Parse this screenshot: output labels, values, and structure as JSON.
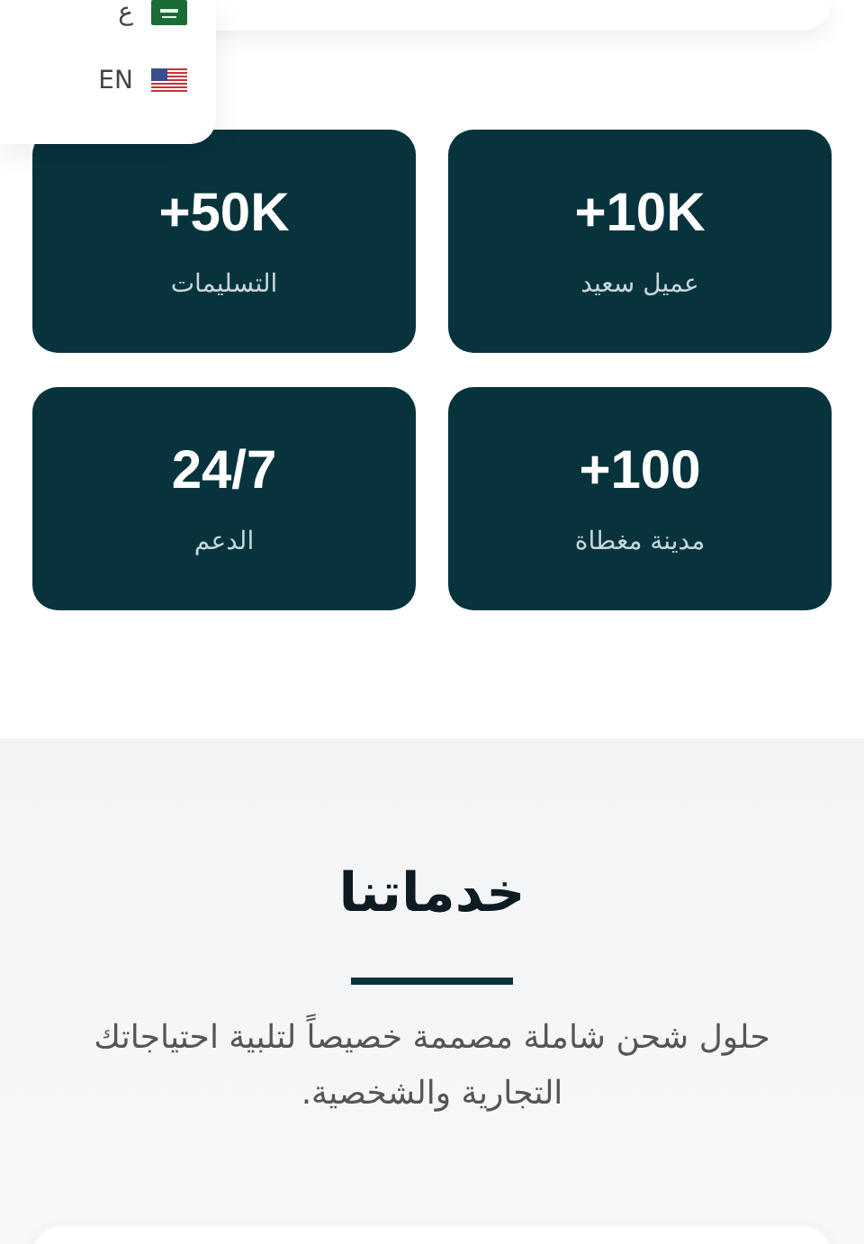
{
  "language_menu": {
    "items": [
      {
        "label": "ع",
        "kind": "sa"
      },
      {
        "label": "EN",
        "kind": "us"
      }
    ]
  },
  "stats": [
    {
      "value": "+10K",
      "label": "عميل سعيد"
    },
    {
      "value": "+50K",
      "label": "التسليمات"
    },
    {
      "value": "+100",
      "label": "مدينة مغطاة"
    },
    {
      "value": "24/7",
      "label": "الدعم"
    }
  ],
  "services": {
    "title": "خدماتنا",
    "description": "حلول شحن شاملة مصممة خصيصاً لتلبية احتياجاتك التجارية والشخصية."
  }
}
